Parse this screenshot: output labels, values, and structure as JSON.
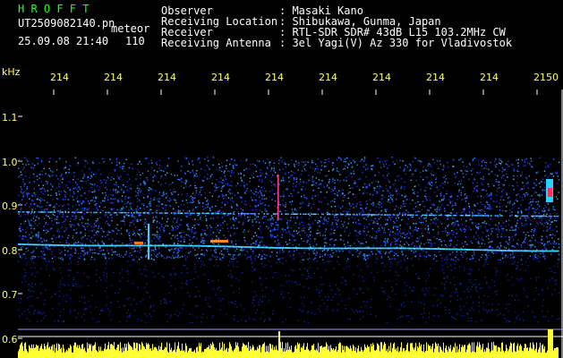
{
  "header": {
    "app_name": "H R O F F T",
    "filename": "UT2509082140.pn",
    "meteor_label": "meteor",
    "datetime": "25.09.08 21:40",
    "count": "110",
    "labels": {
      "observer": "Observer",
      "location": "Receiving Location",
      "receiver": "Receiver",
      "antenna": "Receiving Antenna"
    },
    "values": {
      "observer": ": Masaki Kano",
      "location": ": Shibukawa, Gunma, Japan",
      "receiver": ": RTL-SDR SDR# 43dB L15 103.2MHz CW",
      "antenna": ": 3el Yagi(V) Az 330 for Vladivostok"
    }
  },
  "axis": {
    "unit": "kHz",
    "y_ticks": [
      "1.1",
      "1.0",
      "0.9",
      "0.8",
      "0.7",
      "0.6"
    ],
    "x_ticks": [
      "214",
      "214",
      "214",
      "214",
      "214",
      "214",
      "214",
      "214",
      "214",
      "2150"
    ]
  },
  "colors": {
    "text_green": "#22ff22",
    "text_white": "#ffffff",
    "axis_yellow": "#ffff66",
    "noise_blue": "#2a3cff",
    "signal_cyan": "#40e0ff"
  }
}
